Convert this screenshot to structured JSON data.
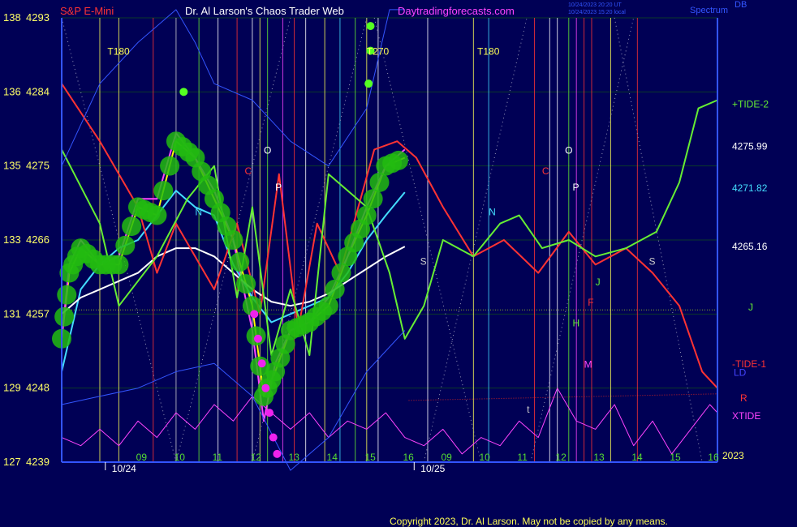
{
  "header": {
    "instrument": "S&P E-Mini",
    "site": "Dr. Al Larson's Chaos Trader Web",
    "url": "Daytradingforecasts.com",
    "info_line1": "10/24/2023 20:20 UT",
    "info_line2": "10/24/2023 15:20 local",
    "corner_1": "DB",
    "corner_2": "Spectrum"
  },
  "footer": {
    "copyright": "Copyright 2023, Dr. Al Larson. May not be copied by any means."
  },
  "chart_data": {
    "type": "line",
    "title": "S&P E-Mini",
    "y_axis": {
      "ticks": [
        {
          "left": "138",
          "right": "4293",
          "value": 4293
        },
        {
          "left": "136",
          "right": "4284",
          "value": 4284
        },
        {
          "left": "135",
          "right": "4275",
          "value": 4275
        },
        {
          "left": "133",
          "right": "4266",
          "value": 4266
        },
        {
          "left": "131",
          "right": "4257",
          "value": 4257
        },
        {
          "left": "129",
          "right": "4248",
          "value": 4248
        },
        {
          "left": "127",
          "right": "4239",
          "value": 4239
        }
      ],
      "ylim": [
        4239,
        4293
      ]
    },
    "x_axis": {
      "hour_ticks": [
        {
          "label": "09",
          "t": 2.1
        },
        {
          "label": "10",
          "t": 3.1
        },
        {
          "label": "11",
          "t": 4.1
        },
        {
          "label": "12",
          "t": 5.1
        },
        {
          "label": "13",
          "t": 6.1
        },
        {
          "label": "14",
          "t": 7.1
        },
        {
          "label": "15",
          "t": 8.1
        },
        {
          "label": "16",
          "t": 9.1
        },
        {
          "label": "09",
          "t": 10.1
        },
        {
          "label": "10",
          "t": 11.1
        },
        {
          "label": "11",
          "t": 12.1
        },
        {
          "label": "12",
          "t": 13.1
        },
        {
          "label": "13",
          "t": 14.1
        },
        {
          "label": "14",
          "t": 15.1
        },
        {
          "label": "15",
          "t": 16.1
        },
        {
          "label": "16",
          "t": 17.1
        }
      ],
      "date_labels": [
        {
          "label": "10/24",
          "t": 1.4
        },
        {
          "label": "10/25",
          "t": 9.5
        }
      ],
      "year_label": "2023",
      "xlim": [
        0,
        17.2
      ]
    },
    "right_labels": [
      {
        "text": "+TIDE-2",
        "color": "#66ee33",
        "y": 4282.5
      },
      {
        "text": "4275.99",
        "color": "#ffffff",
        "y": 4277.4
      },
      {
        "text": "4271.82",
        "color": "#44ddff",
        "y": 4272.3
      },
      {
        "text": "4265.16",
        "color": "#ffffff",
        "y": 4265.2
      },
      {
        "text": "J",
        "color": "#66ee33",
        "y": 4257.8
      },
      {
        "text": "-TIDE-1",
        "color": "#ff3333",
        "y": 4250.9
      },
      {
        "text": "LD",
        "color": "#4444ff",
        "y": 4249.9
      },
      {
        "text": "R",
        "color": "#ff3333",
        "y": 4246.8
      },
      {
        "text": "XTIDE",
        "color": "#ff44ff",
        "y": 4244.6
      }
    ],
    "annotations": [
      {
        "text": "T180",
        "t": 1.2,
        "y": 4288.5,
        "color": "#ffff55"
      },
      {
        "text": "T270",
        "t": 8.0,
        "y": 4288.5,
        "color": "#ffff55"
      },
      {
        "text": "T180",
        "t": 10.9,
        "y": 4288.5,
        "color": "#ffff55"
      },
      {
        "text": "O",
        "t": 5.3,
        "y": 4276.5,
        "color": "#ffffff"
      },
      {
        "text": "O",
        "t": 13.2,
        "y": 4276.5,
        "color": "#ffffff"
      },
      {
        "text": "P",
        "t": 5.6,
        "y": 4272.0,
        "color": "#ffffff"
      },
      {
        "text": "P",
        "t": 13.4,
        "y": 4272.0,
        "color": "#ffffff"
      },
      {
        "text": "C",
        "t": 4.8,
        "y": 4274.0,
        "color": "#ff3333"
      },
      {
        "text": "C",
        "t": 12.6,
        "y": 4274.0,
        "color": "#ff3333"
      },
      {
        "text": "N",
        "t": 3.5,
        "y": 4269.0,
        "color": "#44ddff"
      },
      {
        "text": "N",
        "t": 11.2,
        "y": 4269.0,
        "color": "#44ddff"
      },
      {
        "text": "S",
        "t": 9.4,
        "y": 4263.0,
        "color": "#cccccc"
      },
      {
        "text": "S",
        "t": 15.4,
        "y": 4263.0,
        "color": "#cccccc"
      },
      {
        "text": "J",
        "t": 14.0,
        "y": 4260.5,
        "color": "#66ee33"
      },
      {
        "text": "F",
        "t": 13.8,
        "y": 4258.0,
        "color": "#ff3333"
      },
      {
        "text": "H",
        "t": 13.4,
        "y": 4255.5,
        "color": "#66ee33"
      },
      {
        "text": "M",
        "t": 13.7,
        "y": 4250.5,
        "color": "#ff44ff"
      },
      {
        "text": "t",
        "t": 12.2,
        "y": 4245.0,
        "color": "#cccccc"
      }
    ],
    "series": [
      {
        "color": "#ffff00",
        "t": [
          0,
          0.2,
          0.5,
          1.0,
          1.5,
          2.0,
          2.5,
          3.0,
          3.5,
          4.0,
          4.5,
          5.0,
          5.3,
          5.6,
          6.0,
          6.5,
          7.0,
          7.5,
          8.0,
          8.5,
          9.0
        ],
        "y": [
          4254,
          4262,
          4265,
          4263,
          4263,
          4270,
          4269,
          4278,
          4276,
          4271,
          4266,
          4258,
          4247,
          4250,
          4255,
          4256,
          4258,
          4264,
          4269,
          4275,
          4276
        ]
      },
      {
        "color": "#ff44ff",
        "t": [
          0,
          0.2,
          0.5,
          1.0,
          1.5,
          2.0,
          2.5,
          3.0,
          3.5,
          4.0,
          4.5,
          5.0,
          5.3,
          5.6,
          6.0,
          6.5,
          7.0,
          7.5,
          8.0,
          8.5,
          9.0
        ],
        "y": [
          4254,
          4263,
          4266,
          4263,
          4264,
          4271,
          4271,
          4279,
          4276,
          4272,
          4266,
          4255,
          4244,
          4251,
          4255,
          4256,
          4259,
          4264,
          4270,
          4275,
          4277
        ]
      },
      {
        "color": "#44ddff",
        "t": [
          0,
          0.5,
          1.0,
          1.5,
          2.0,
          2.5,
          3.0,
          3.5,
          4.0,
          4.5,
          5.0,
          5.5,
          6.0,
          6.5,
          7.0,
          7.5,
          8.0,
          8.5,
          9.0
        ],
        "y": [
          4250,
          4260,
          4263,
          4265,
          4266,
          4269,
          4272,
          4270,
          4269,
          4263,
          4259,
          4256,
          4257,
          4258,
          4259,
          4262,
          4266,
          4269,
          4271.8
        ]
      },
      {
        "color": "#ffffff",
        "t": [
          0,
          0.5,
          1.0,
          1.5,
          2.0,
          2.5,
          3.0,
          3.5,
          4.0,
          4.5,
          5.0,
          5.5,
          6.0,
          6.5,
          7.0,
          7.5,
          8.0,
          8.5,
          9.0
        ],
        "y": [
          4257,
          4259,
          4260,
          4261,
          4262,
          4264,
          4265,
          4265,
          4264,
          4262,
          4260,
          4258.5,
          4258,
          4258.5,
          4259.5,
          4261,
          4262.5,
          4264,
          4265.2
        ]
      },
      {
        "color": "#ff3333",
        "t": [
          0,
          1,
          2,
          2.5,
          3,
          4,
          4.6,
          5.2,
          5.7,
          6.2,
          6.7,
          7.3,
          8.2,
          8.8,
          9.3,
          10,
          10.8,
          11.6,
          12.5,
          13.3,
          14,
          14.8,
          15.5,
          16.2,
          16.8,
          17.2
        ],
        "y": [
          4285,
          4278,
          4270,
          4262,
          4268,
          4260,
          4268,
          4257,
          4274,
          4255,
          4268,
          4262,
          4277,
          4278,
          4276,
          4270,
          4264,
          4266,
          4262,
          4267,
          4263,
          4265,
          4262,
          4258,
          4250,
          4248
        ]
      },
      {
        "color": "#66ee33",
        "t": [
          0,
          1,
          1.5,
          2.5,
          3.3,
          4,
          4.6,
          5.0,
          5.5,
          6.0,
          6.5,
          7,
          8,
          8.6,
          9,
          9.5,
          10,
          10.8,
          11.5,
          12,
          12.6,
          13.3,
          14,
          14.8,
          15.6,
          16.2,
          16.7,
          17.2
        ],
        "y": [
          4277,
          4268,
          4258,
          4264,
          4271,
          4275,
          4259,
          4270,
          4252,
          4260,
          4252,
          4274,
          4270,
          4262,
          4254,
          4258,
          4266,
          4264,
          4268,
          4269,
          4265,
          4266,
          4264,
          4265,
          4267,
          4273,
          4282,
          4283
        ]
      },
      {
        "color": "#ff44ff",
        "width": 1,
        "t": [
          0,
          0.5,
          1,
          1.5,
          2,
          2.5,
          3,
          3.5,
          4,
          4.5,
          5,
          5.5,
          6,
          6.5,
          7,
          7.5,
          8,
          8.5,
          9,
          9.5,
          10,
          10.5,
          11,
          11.5,
          12,
          12.5,
          13,
          13.5,
          14,
          14.5,
          15,
          15.5,
          16,
          16.5,
          17,
          17.2
        ],
        "y": [
          4242,
          4241,
          4243,
          4241,
          4244,
          4242,
          4245,
          4243,
          4246,
          4244,
          4247,
          4245,
          4243,
          4245,
          4242,
          4244,
          4243,
          4245,
          4242,
          4241,
          4243,
          4240,
          4242,
          4241,
          4244,
          4242,
          4248,
          4244,
          4243,
          4246,
          4241,
          4244,
          4240,
          4243,
          4246,
          4245
        ]
      },
      {
        "color": "#3355ff",
        "width": 1,
        "t": [
          0,
          1,
          2,
          3,
          3.5,
          4,
          5,
          6,
          7,
          8,
          8.6,
          9
        ],
        "y": [
          4275,
          4285,
          4290,
          4294,
          4290,
          4285,
          4283,
          4278,
          4275,
          4282,
          4294,
          4294
        ]
      },
      {
        "color": "#3355ff",
        "width": 1,
        "t": [
          0,
          1,
          2,
          3,
          4,
          5,
          6,
          7,
          8,
          9
        ],
        "y": [
          4246,
          4247,
          4248,
          4250,
          4251,
          4247,
          4238,
          4242,
          4250,
          4255
        ]
      }
    ]
  }
}
